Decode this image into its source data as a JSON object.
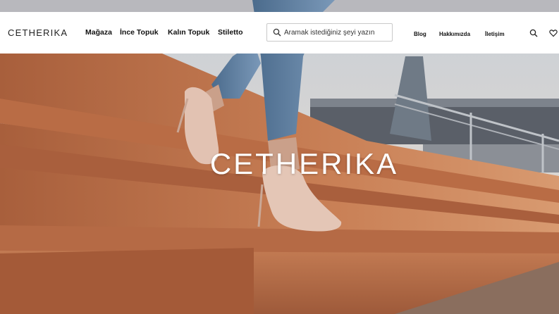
{
  "brand": {
    "logo_text": "CETHERIKA"
  },
  "nav": {
    "items": [
      {
        "label": "Mağaza"
      },
      {
        "label": "İnce Topuk"
      },
      {
        "label": "Kalın Topuk"
      },
      {
        "label": "Stiletto"
      }
    ]
  },
  "search": {
    "placeholder": "Aramak istediğiniz şeyi yazın"
  },
  "links": {
    "blog": "Blog",
    "about": "Hakkımızda",
    "contact": "İletişim"
  },
  "icons": {
    "search": "search-icon",
    "wishlist": "heart-icon"
  },
  "hero": {
    "title": "CETHERIKA"
  },
  "colors": {
    "header_bg": "#ffffff",
    "text": "#111111",
    "hero_title": "#ffffff"
  }
}
